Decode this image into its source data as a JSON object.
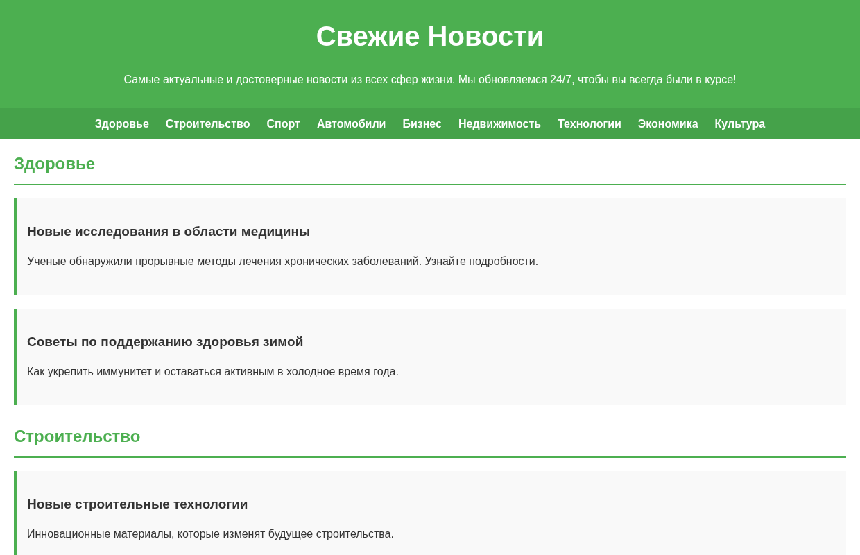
{
  "header": {
    "title": "Свежие Новости",
    "subtitle": "Самые актуальные и достоверные новости из всех сфер жизни. Мы обновляемся 24/7, чтобы вы всегда были в курсе!"
  },
  "nav": {
    "items": [
      "Здоровье",
      "Строительство",
      "Спорт",
      "Автомобили",
      "Бизнес",
      "Недвижимость",
      "Технологии",
      "Экономика",
      "Культура"
    ]
  },
  "sections": [
    {
      "title": "Здоровье",
      "articles": [
        {
          "title": "Новые исследования в области медицины",
          "text": "Ученые обнаружили прорывные методы лечения хронических заболеваний. Узнайте подробности."
        },
        {
          "title": "Советы по поддержанию здоровья зимой",
          "text": "Как укрепить иммунитет и оставаться активным в холодное время года."
        }
      ]
    },
    {
      "title": "Строительство",
      "articles": [
        {
          "title": "Новые строительные технологии",
          "text": "Инновационные материалы, которые изменят будущее строительства."
        }
      ]
    }
  ]
}
